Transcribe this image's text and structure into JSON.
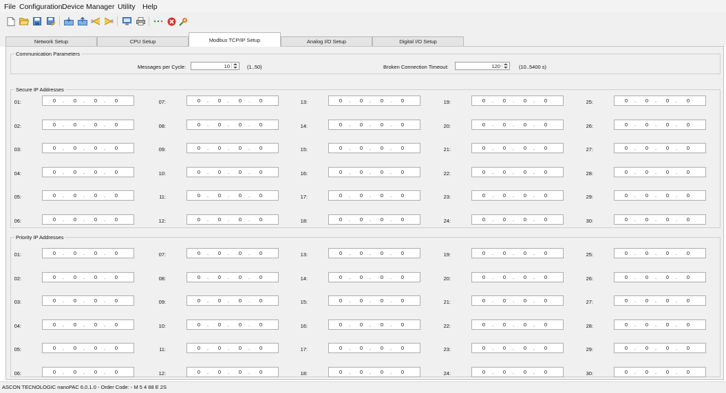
{
  "menu": {
    "items": [
      "File",
      "Configuration",
      "Device Manager",
      "Utility",
      "Help"
    ]
  },
  "toolbar": {
    "icons": [
      "new-file-icon",
      "open-folder-icon",
      "save-icon",
      "save-as-icon",
      "import-icon",
      "export-icon",
      "upload-icon",
      "download-icon",
      "monitor-icon",
      "print-icon",
      "more-icon",
      "stop-icon",
      "connect-icon"
    ]
  },
  "tabs": [
    {
      "label": "Network Setup",
      "active": false
    },
    {
      "label": "CPU Setup",
      "active": false
    },
    {
      "label": "Modbus TCP/IP Setup",
      "active": true
    },
    {
      "label": "Analog I/O Setup",
      "active": false
    },
    {
      "label": "Digital I/O Setup",
      "active": false
    }
  ],
  "comm": {
    "title": "Communication Parameters",
    "messages_label": "Messages per Cycle:",
    "messages_value": "10",
    "messages_range": "(1..50)",
    "timeout_label": "Broken Connection Timeout:",
    "timeout_value": "120",
    "timeout_range": "(10..5400 s)"
  },
  "secure": {
    "title": "Secure IP Addresses",
    "entries": [
      {
        "label": "01:",
        "ip": [
          "0",
          "0",
          "0",
          "0"
        ]
      },
      {
        "label": "02:",
        "ip": [
          "0",
          "0",
          "0",
          "0"
        ]
      },
      {
        "label": "03:",
        "ip": [
          "0",
          "0",
          "0",
          "0"
        ]
      },
      {
        "label": "04:",
        "ip": [
          "0",
          "0",
          "0",
          "0"
        ]
      },
      {
        "label": "05:",
        "ip": [
          "0",
          "0",
          "0",
          "0"
        ]
      },
      {
        "label": "06:",
        "ip": [
          "0",
          "0",
          "0",
          "0"
        ]
      },
      {
        "label": "07:",
        "ip": [
          "0",
          "0",
          "0",
          "0"
        ]
      },
      {
        "label": "08:",
        "ip": [
          "0",
          "0",
          "0",
          "0"
        ]
      },
      {
        "label": "09:",
        "ip": [
          "0",
          "0",
          "0",
          "0"
        ]
      },
      {
        "label": "10:",
        "ip": [
          "0",
          "0",
          "0",
          "0"
        ]
      },
      {
        "label": "11:",
        "ip": [
          "0",
          "0",
          "0",
          "0"
        ]
      },
      {
        "label": "12:",
        "ip": [
          "0",
          "0",
          "0",
          "0"
        ]
      },
      {
        "label": "13:",
        "ip": [
          "0",
          "0",
          "0",
          "0"
        ]
      },
      {
        "label": "14:",
        "ip": [
          "0",
          "0",
          "0",
          "0"
        ]
      },
      {
        "label": "15:",
        "ip": [
          "0",
          "0",
          "0",
          "0"
        ]
      },
      {
        "label": "16:",
        "ip": [
          "0",
          "0",
          "0",
          "0"
        ]
      },
      {
        "label": "17:",
        "ip": [
          "0",
          "0",
          "0",
          "0"
        ]
      },
      {
        "label": "18:",
        "ip": [
          "0",
          "0",
          "0",
          "0"
        ]
      },
      {
        "label": "19:",
        "ip": [
          "0",
          "0",
          "0",
          "0"
        ]
      },
      {
        "label": "20:",
        "ip": [
          "0",
          "0",
          "0",
          "0"
        ]
      },
      {
        "label": "21:",
        "ip": [
          "0",
          "0",
          "0",
          "0"
        ]
      },
      {
        "label": "22:",
        "ip": [
          "0",
          "0",
          "0",
          "0"
        ]
      },
      {
        "label": "23:",
        "ip": [
          "0",
          "0",
          "0",
          "0"
        ]
      },
      {
        "label": "24:",
        "ip": [
          "0",
          "0",
          "0",
          "0"
        ]
      },
      {
        "label": "25:",
        "ip": [
          "0",
          "0",
          "0",
          "0"
        ]
      },
      {
        "label": "26:",
        "ip": [
          "0",
          "0",
          "0",
          "0"
        ]
      },
      {
        "label": "27:",
        "ip": [
          "0",
          "0",
          "0",
          "0"
        ]
      },
      {
        "label": "28:",
        "ip": [
          "0",
          "0",
          "0",
          "0"
        ]
      },
      {
        "label": "29:",
        "ip": [
          "0",
          "0",
          "0",
          "0"
        ]
      },
      {
        "label": "30:",
        "ip": [
          "0",
          "0",
          "0",
          "0"
        ]
      }
    ]
  },
  "priority": {
    "title": "Priority IP Addresses",
    "entries": [
      {
        "label": "01:",
        "ip": [
          "0",
          "0",
          "0",
          "0"
        ]
      },
      {
        "label": "02:",
        "ip": [
          "0",
          "0",
          "0",
          "0"
        ]
      },
      {
        "label": "03:",
        "ip": [
          "0",
          "0",
          "0",
          "0"
        ]
      },
      {
        "label": "04:",
        "ip": [
          "0",
          "0",
          "0",
          "0"
        ]
      },
      {
        "label": "05:",
        "ip": [
          "0",
          "0",
          "0",
          "0"
        ]
      },
      {
        "label": "06:",
        "ip": [
          "0",
          "0",
          "0",
          "0"
        ]
      },
      {
        "label": "07:",
        "ip": [
          "0",
          "0",
          "0",
          "0"
        ]
      },
      {
        "label": "08:",
        "ip": [
          "0",
          "0",
          "0",
          "0"
        ]
      },
      {
        "label": "09:",
        "ip": [
          "0",
          "0",
          "0",
          "0"
        ]
      },
      {
        "label": "10:",
        "ip": [
          "0",
          "0",
          "0",
          "0"
        ]
      },
      {
        "label": "11:",
        "ip": [
          "0",
          "0",
          "0",
          "0"
        ]
      },
      {
        "label": "12:",
        "ip": [
          "0",
          "0",
          "0",
          "0"
        ]
      },
      {
        "label": "13:",
        "ip": [
          "0",
          "0",
          "0",
          "0"
        ]
      },
      {
        "label": "14:",
        "ip": [
          "0",
          "0",
          "0",
          "0"
        ]
      },
      {
        "label": "15:",
        "ip": [
          "0",
          "0",
          "0",
          "0"
        ]
      },
      {
        "label": "16:",
        "ip": [
          "0",
          "0",
          "0",
          "0"
        ]
      },
      {
        "label": "17:",
        "ip": [
          "0",
          "0",
          "0",
          "0"
        ]
      },
      {
        "label": "18:",
        "ip": [
          "0",
          "0",
          "0",
          "0"
        ]
      },
      {
        "label": "19:",
        "ip": [
          "0",
          "0",
          "0",
          "0"
        ]
      },
      {
        "label": "20:",
        "ip": [
          "0",
          "0",
          "0",
          "0"
        ]
      },
      {
        "label": "21:",
        "ip": [
          "0",
          "0",
          "0",
          "0"
        ]
      },
      {
        "label": "22:",
        "ip": [
          "0",
          "0",
          "0",
          "0"
        ]
      },
      {
        "label": "23:",
        "ip": [
          "0",
          "0",
          "0",
          "0"
        ]
      },
      {
        "label": "24:",
        "ip": [
          "0",
          "0",
          "0",
          "0"
        ]
      },
      {
        "label": "25:",
        "ip": [
          "0",
          "0",
          "0",
          "0"
        ]
      },
      {
        "label": "26:",
        "ip": [
          "0",
          "0",
          "0",
          "0"
        ]
      },
      {
        "label": "27:",
        "ip": [
          "0",
          "0",
          "0",
          "0"
        ]
      },
      {
        "label": "28:",
        "ip": [
          "0",
          "0",
          "0",
          "0"
        ]
      },
      {
        "label": "29:",
        "ip": [
          "0",
          "0",
          "0",
          "0"
        ]
      },
      {
        "label": "30:",
        "ip": [
          "0",
          "0",
          "0",
          "0"
        ]
      }
    ]
  },
  "status": {
    "text": "ASCON TECNOLOGIC nanoPAC 6.0.1.0 - Order Code: - M 5 4 88 E 2S"
  }
}
